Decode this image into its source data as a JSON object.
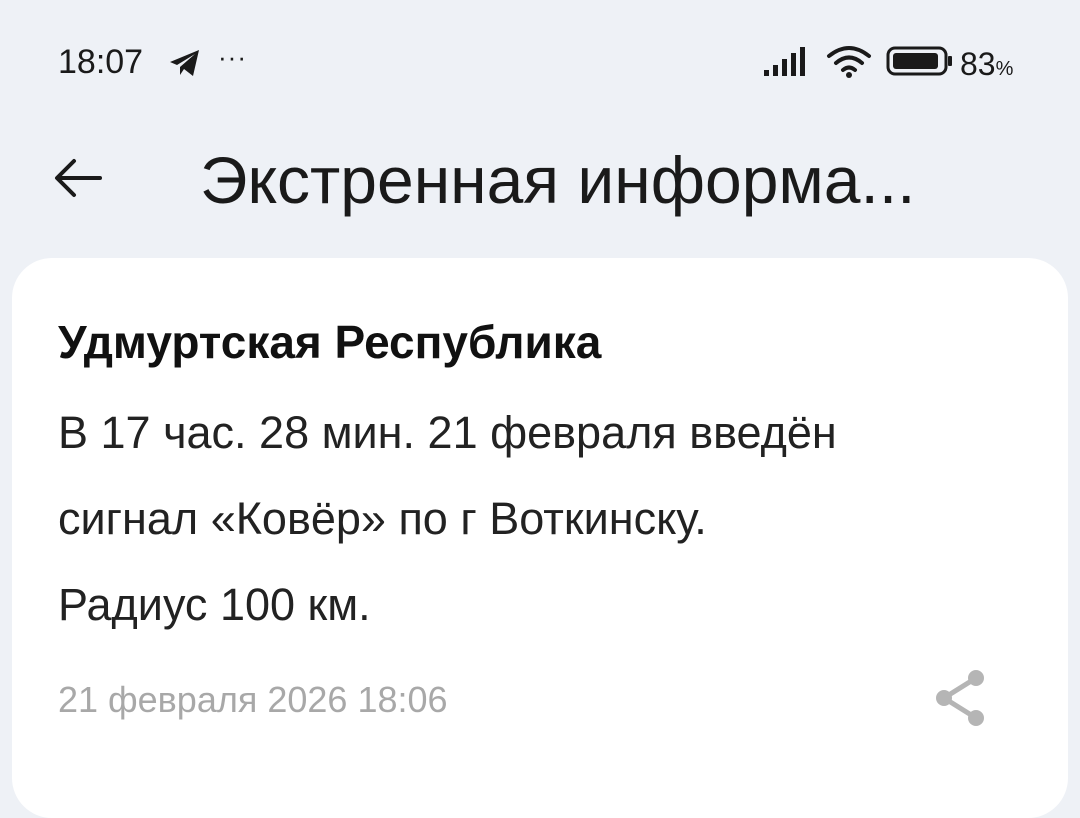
{
  "status_bar": {
    "time": "18:07",
    "notifications_more": "···",
    "battery_level": "83",
    "battery_unit": "%"
  },
  "header": {
    "title": "Экстренная информа..."
  },
  "alert": {
    "region": "Удмуртская Республика",
    "message_lines": [
      "В 17 час. 28 мин. 21 февраля введён",
      "сигнал «Ковёр» по г Воткинску.",
      "Радиус 100 км."
    ],
    "datetime": "21 февраля 2026 18:06"
  },
  "icons": {
    "back": "arrow-left-icon",
    "share": "share-icon",
    "telegram": "telegram-icon",
    "signal": "signal-icon",
    "wifi": "wifi-icon",
    "battery": "battery-icon"
  },
  "colors": {
    "background": "#eef1f6",
    "card": "#ffffff",
    "text": "#111111",
    "muted": "#a8a8a8"
  }
}
